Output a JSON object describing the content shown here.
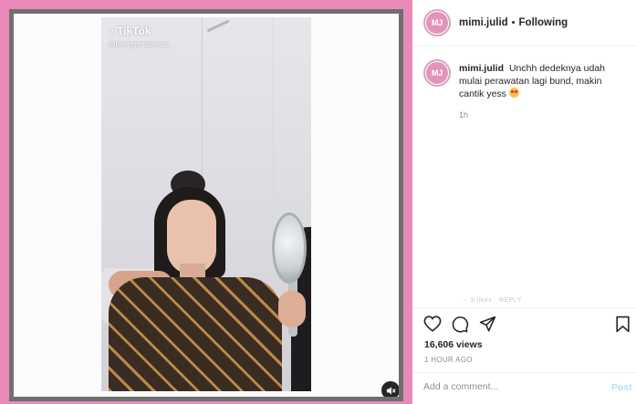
{
  "post": {
    "username": "mimi.julid",
    "follow_separator": "•",
    "follow_status": "Following",
    "avatar_initials": "MJ",
    "caption": {
      "username": "mimi.julid",
      "text": "Unchh dedeknya udah mulai perawatan lagi bund, makin cantik yess",
      "emoji": "star-struck-emoji",
      "relative_time": "1h"
    },
    "scroll_remnant": "···  9 likes  ·  REPLY",
    "views": "16,606 views",
    "timestamp": "1 HOUR AGO",
    "comment": {
      "placeholder": "Add a comment...",
      "post_label": "Post"
    }
  },
  "video": {
    "watermark_brand": "TikTok",
    "watermark_handle": "@beningsindonesia"
  },
  "icons": {
    "like": "heart-icon",
    "comment": "comment-icon",
    "share": "share-icon",
    "save": "bookmark-icon",
    "mute": "muted-speaker-icon"
  },
  "colors": {
    "frame_pink": "#ea8ab8",
    "post_button_disabled": "#b2dffc",
    "text_primary": "#262626",
    "text_secondary": "#8e8e8e"
  }
}
